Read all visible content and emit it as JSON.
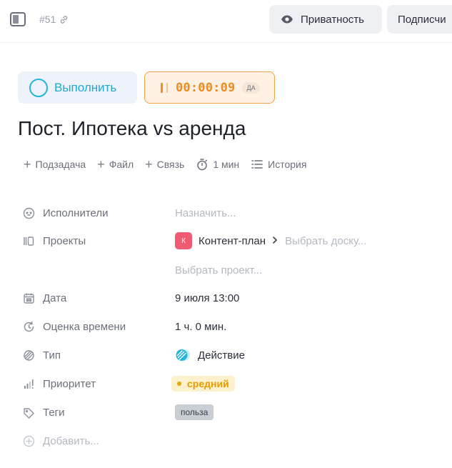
{
  "topbar": {
    "task_id": "#51",
    "privacy_label": "Приватность",
    "subscribe_label": "Подписчи"
  },
  "actions": {
    "complete_label": "Выполнить",
    "timer_value": "00:00:09",
    "timer_badge": "ДА"
  },
  "task": {
    "title": "Пост. Ипотека vs аренда"
  },
  "quick_actions": {
    "subtask": "Подзадача",
    "file": "Файл",
    "link": "Связь",
    "time": "1 мин",
    "history": "История"
  },
  "properties": {
    "assignees": {
      "label": "Исполнители",
      "value": "Назначить..."
    },
    "projects": {
      "label": "Проекты",
      "badge": "К",
      "project": "Контент-план",
      "board": "Выбрать доску...",
      "pick_project": "Выбрать проект..."
    },
    "date": {
      "label": "Дата",
      "value": "9 июля 13:00"
    },
    "estimate": {
      "label": "Оценка времени",
      "value": "1 ч. 0 мин."
    },
    "type": {
      "label": "Тип",
      "value": "Действие"
    },
    "priority": {
      "label": "Приоритет",
      "value": "средний"
    },
    "tags": {
      "label": "Теги",
      "value": "польза"
    },
    "add": {
      "label": "Добавить..."
    }
  },
  "colors": {
    "accent": "#1fb6d9",
    "timer": "#ef8b1f",
    "project_badge": "#f05a73",
    "priority": "#e69b00"
  },
  "icons": [
    "panel-toggle-icon",
    "link-icon",
    "eye-icon",
    "pause-icon",
    "plus-icon",
    "stopwatch-icon",
    "list-icon",
    "assignee-icon",
    "projects-icon",
    "calendar-icon",
    "refresh-icon",
    "type-icon",
    "signal-icon",
    "tag-icon",
    "add-circle-icon",
    "chevron-right-icon"
  ]
}
